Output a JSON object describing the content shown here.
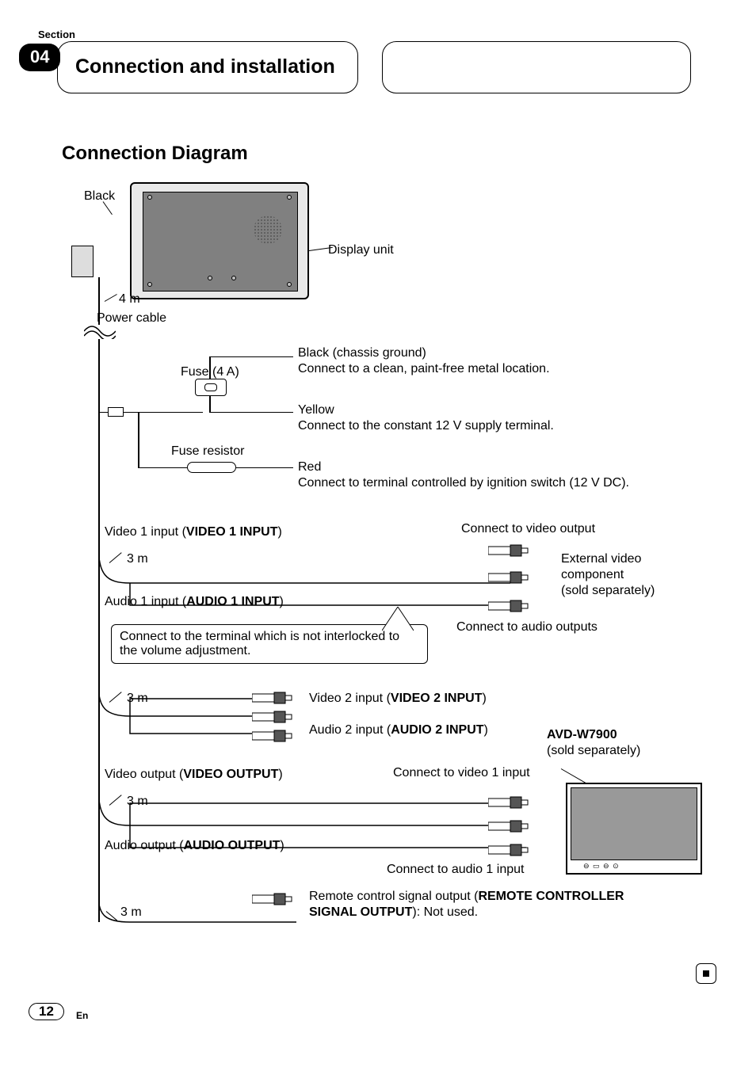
{
  "header": {
    "section_label": "Section",
    "section_number": "04",
    "title": "Connection and installation"
  },
  "heading": "Connection Diagram",
  "labels": {
    "black": "Black",
    "display_unit": "Display unit",
    "length_4m": "4 m",
    "power_cable": "Power cable",
    "fuse_4a": "Fuse (4 A)",
    "black_chassis_line1": "Black (chassis ground)",
    "black_chassis_line2": "Connect to a clean, paint-free metal location.",
    "yellow_line1": "Yellow",
    "yellow_line2": "Connect to the constant 12 V supply terminal.",
    "fuse_resistor": "Fuse resistor",
    "red_line1": "Red",
    "red_line2": "Connect to terminal controlled by ignition switch (12 V DC).",
    "video1_prefix": "Video 1 input (",
    "video1_bold": "VIDEO 1 INPUT",
    "video1_suffix": ")",
    "length_3m_1": "3 m",
    "audio1_prefix": "Audio 1 input (",
    "audio1_bold": "AUDIO 1 INPUT",
    "audio1_suffix": ")",
    "callout_text": "Connect to the terminal which is not interlocked to the volume adjustment.",
    "connect_video_output": "Connect to video output",
    "external_video_line1": "External video",
    "external_video_line2": "component",
    "external_video_line3": "(sold separately)",
    "connect_audio_outputs": "Connect to audio outputs",
    "length_3m_2": "3 m",
    "video2_prefix": "Video 2 input (",
    "video2_bold": "VIDEO 2 INPUT",
    "video2_suffix": ")",
    "audio2_prefix": "Audio 2 input (",
    "audio2_bold": "AUDIO 2 INPUT",
    "audio2_suffix": ")",
    "model_bold": "AVD-W7900",
    "model_note": "(sold separately)",
    "videoout_prefix": "Video output (",
    "videoout_bold": "VIDEO OUTPUT",
    "videoout_suffix": ")",
    "length_3m_3": "3 m",
    "audioout_prefix": "Audio output (",
    "audioout_bold": "AUDIO OUTPUT",
    "audioout_suffix": ")",
    "connect_video1_input": "Connect to video 1 input",
    "connect_audio1_input": "Connect to audio 1 input",
    "length_3m_4": "3 m",
    "remote_prefix": "Remote control signal output (",
    "remote_bold1": "REMOTE CONTROLLER",
    "remote_bold2": "SIGNAL OUTPUT",
    "remote_suffix": "): Not used."
  },
  "footer": {
    "page": "12",
    "lang": "En"
  }
}
